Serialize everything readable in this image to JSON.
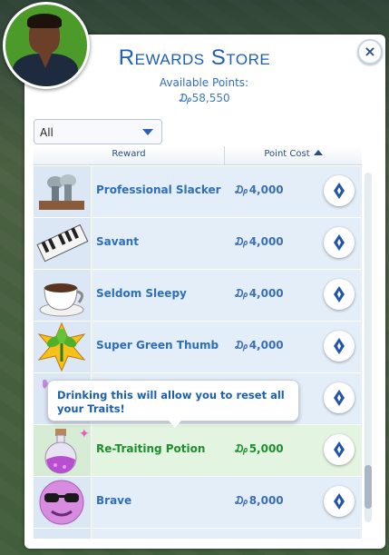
{
  "window": {
    "title": "Rewards Store",
    "available_points_label": "Available Points:",
    "available_points_value": "₯58,550",
    "close_glyph": "×"
  },
  "filter": {
    "selected": "All"
  },
  "table": {
    "columns": [
      "Reward",
      "Point Cost"
    ],
    "sort_column": "Point Cost",
    "sort_direction": "ascending"
  },
  "rewards": [
    {
      "name": "Professional Slacker",
      "cost": "₯4,000",
      "icon": "feet-on-desk-icon"
    },
    {
      "name": "Savant",
      "cost": "₯4,000",
      "icon": "piano-keys-icon"
    },
    {
      "name": "Seldom Sleepy",
      "cost": "₯4,000",
      "icon": "coffee-cup-icon"
    },
    {
      "name": "Super Green Thumb",
      "cost": "₯4,000",
      "icon": "green-thumb-plant-icon"
    },
    {
      "name": "",
      "cost": "",
      "icon": "partial-icon"
    },
    {
      "name": "Re-Traiting Potion",
      "cost": "₯5,000",
      "icon": "potion-bottle-icon",
      "selected": true
    },
    {
      "name": "Brave",
      "cost": "₯8,000",
      "icon": "sunglasses-face-icon"
    }
  ],
  "tooltip": {
    "text": "Drinking this will allow you to reset all your Traits!"
  },
  "scrollbar": {
    "position_fraction": 0.88
  },
  "colors": {
    "accent_blue": "#1d5fb7",
    "selected_green": "#1f8f2e",
    "row_bg": "#e4eef8",
    "selected_row_bg": "#e3f5e1"
  }
}
